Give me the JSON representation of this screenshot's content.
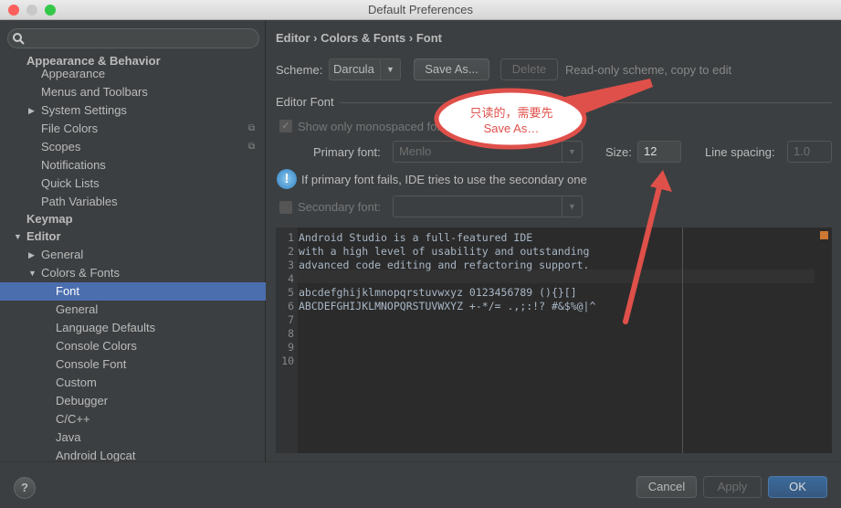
{
  "window": {
    "title": "Default Preferences"
  },
  "sidebar": {
    "search_placeholder": "",
    "items": [
      {
        "label": "Appearance & Behavior"
      },
      {
        "label": "Appearance"
      },
      {
        "label": "Menus and Toolbars"
      },
      {
        "label": "System Settings"
      },
      {
        "label": "File Colors"
      },
      {
        "label": "Scopes"
      },
      {
        "label": "Notifications"
      },
      {
        "label": "Quick Lists"
      },
      {
        "label": "Path Variables"
      },
      {
        "label": "Keymap"
      },
      {
        "label": "Editor"
      },
      {
        "label": "General"
      },
      {
        "label": "Colors & Fonts"
      },
      {
        "label": "Font"
      },
      {
        "label": "General"
      },
      {
        "label": "Language Defaults"
      },
      {
        "label": "Console Colors"
      },
      {
        "label": "Console Font"
      },
      {
        "label": "Custom"
      },
      {
        "label": "Debugger"
      },
      {
        "label": "C/C++"
      },
      {
        "label": "Java"
      },
      {
        "label": "Android Logcat"
      }
    ]
  },
  "main": {
    "breadcrumb": "Editor › Colors & Fonts › Font",
    "scheme_label": "Scheme:",
    "scheme_value": "Darcula",
    "save_as": "Save As...",
    "delete": "Delete",
    "readonly_note": "Read-only scheme, copy to edit",
    "section": "Editor Font",
    "mono_label": "Show only monospaced fonts",
    "primary_label": "Primary font:",
    "primary_value": "Menlo",
    "size_label": "Size:",
    "size_value": "12",
    "spacing_label": "Line spacing:",
    "spacing_value": "1.0",
    "info": "If primary font fails, IDE tries to use the secondary one",
    "secondary_label": "Secondary font:",
    "secondary_value": ""
  },
  "preview": {
    "lines": [
      "Android Studio is a full-featured IDE",
      "with a high level of usability and outstanding",
      "advanced code editing and refactoring support.",
      "",
      "abcdefghijklmnopqrstuvwxyz 0123456789 (){}[]",
      "ABCDEFGHIJKLMNOPQRSTUVWXYZ +-*/= .,;:!? #&$%@|^",
      "",
      "",
      "",
      ""
    ],
    "numbers": [
      "1",
      "2",
      "3",
      "4",
      "5",
      "6",
      "7",
      "8",
      "9",
      "10"
    ]
  },
  "annotation": {
    "line1": "只读的，需要先",
    "line2": "Save As…"
  },
  "footer": {
    "help": "?",
    "cancel": "Cancel",
    "apply": "Apply",
    "ok": "OK"
  },
  "colors": {
    "selection": "#4b6eaf",
    "annotation_red": "#e0504a"
  }
}
